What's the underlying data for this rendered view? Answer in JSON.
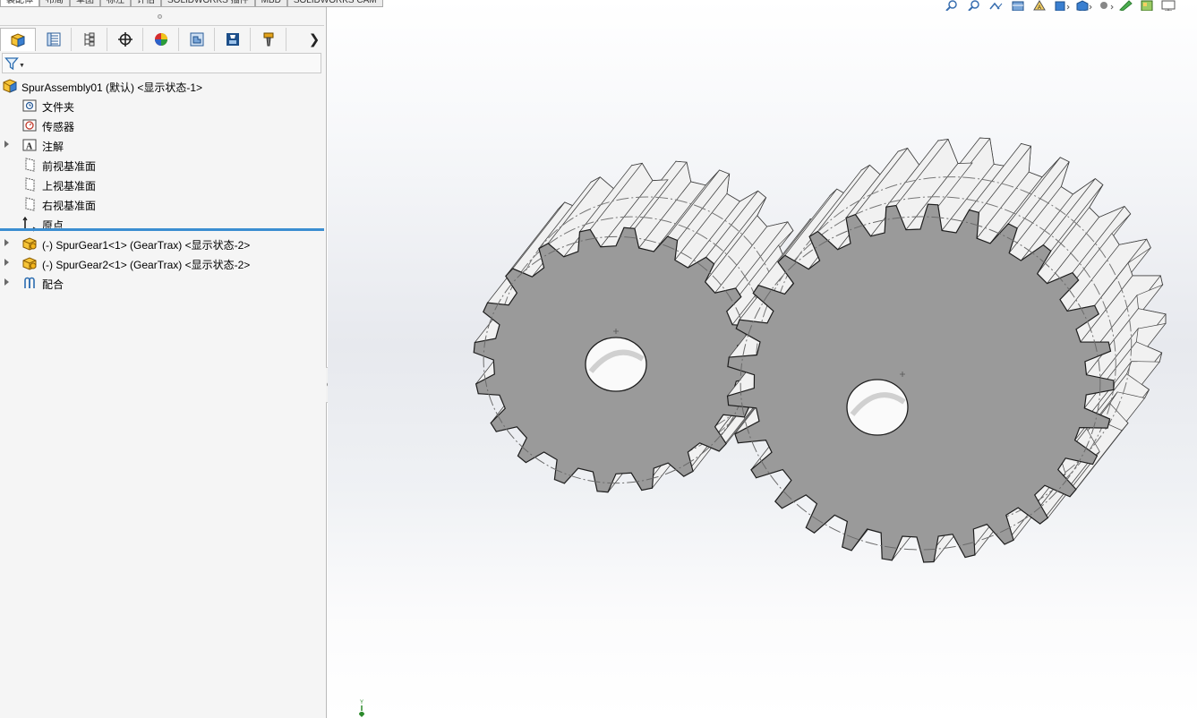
{
  "ribbon": {
    "tabs": [
      {
        "label": "装配体",
        "active": true
      },
      {
        "label": "布局",
        "active": false
      },
      {
        "label": "草图",
        "active": false
      },
      {
        "label": "标注",
        "active": false
      },
      {
        "label": "评估",
        "active": false
      },
      {
        "label": "SOLIDWORKS 插件",
        "active": false
      },
      {
        "label": "MBD",
        "active": false
      },
      {
        "label": "SOLIDWORKS CAM",
        "active": false
      }
    ]
  },
  "manager_tabs": [
    {
      "icon": "feature-manager-icon",
      "active": true
    },
    {
      "icon": "property-manager-icon",
      "active": false
    },
    {
      "icon": "configuration-manager-icon",
      "active": false
    },
    {
      "icon": "dimxpert-manager-icon",
      "active": false
    },
    {
      "icon": "display-manager-icon",
      "active": false
    },
    {
      "icon": "cam-feature-tree-icon",
      "active": false
    },
    {
      "icon": "cam-operation-tree-icon",
      "active": false
    },
    {
      "icon": "cam-tool-tree-icon",
      "active": false
    }
  ],
  "tree": {
    "root": "SpurAssembly01 (默认) <显示状态-1>",
    "items": [
      {
        "label": "文件夹",
        "icon": "history-folder-icon",
        "expandable": false
      },
      {
        "label": "传感器",
        "icon": "sensor-icon",
        "expandable": false
      },
      {
        "label": "注解",
        "icon": "annotations-icon",
        "expandable": true
      },
      {
        "label": "前视基准面",
        "icon": "plane-icon",
        "expandable": false
      },
      {
        "label": "上视基准面",
        "icon": "plane-icon",
        "expandable": false
      },
      {
        "label": "右视基准面",
        "icon": "plane-icon",
        "expandable": false
      },
      {
        "label": "原点",
        "icon": "origin-icon",
        "expandable": false
      },
      {
        "label": "(-) SpurGear1<1> (GearTrax) <显示状态-2>",
        "icon": "part-icon",
        "expandable": true
      },
      {
        "label": "(-) SpurGear2<1> (GearTrax) <显示状态-2>",
        "icon": "part-icon",
        "expandable": true
      },
      {
        "label": "配合",
        "icon": "mates-icon",
        "expandable": true
      }
    ]
  },
  "viewport": {
    "gears": [
      {
        "name": "SpurGear1",
        "teeth": 20
      },
      {
        "name": "SpurGear2",
        "teeth": 29
      }
    ],
    "colors": {
      "face": "#9a9a9a",
      "flank": "#f1f1f1",
      "edge": "#1e1e1e",
      "triad_y": "#2c8a2c"
    },
    "triad_label": "Y"
  },
  "view_toolbar": [
    "zoom-to-fit-icon",
    "zoom-area-icon",
    "previous-view-icon",
    "section-view-icon",
    "dynamic-annotation-icon",
    "view-orientation-icon",
    "display-style-icon",
    "hide-show-icon",
    "edit-appearance-icon",
    "apply-scene-icon",
    "view-settings-icon"
  ]
}
